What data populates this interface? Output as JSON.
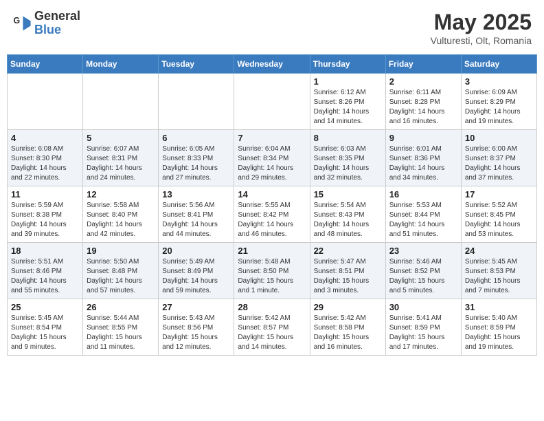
{
  "header": {
    "logo_general": "General",
    "logo_blue": "Blue",
    "month_title": "May 2025",
    "location": "Vulturesti, Olt, Romania"
  },
  "days_of_week": [
    "Sunday",
    "Monday",
    "Tuesday",
    "Wednesday",
    "Thursday",
    "Friday",
    "Saturday"
  ],
  "weeks": [
    [
      {
        "num": "",
        "detail": ""
      },
      {
        "num": "",
        "detail": ""
      },
      {
        "num": "",
        "detail": ""
      },
      {
        "num": "",
        "detail": ""
      },
      {
        "num": "1",
        "detail": "Sunrise: 6:12 AM\nSunset: 8:26 PM\nDaylight: 14 hours\nand 14 minutes."
      },
      {
        "num": "2",
        "detail": "Sunrise: 6:11 AM\nSunset: 8:28 PM\nDaylight: 14 hours\nand 16 minutes."
      },
      {
        "num": "3",
        "detail": "Sunrise: 6:09 AM\nSunset: 8:29 PM\nDaylight: 14 hours\nand 19 minutes."
      }
    ],
    [
      {
        "num": "4",
        "detail": "Sunrise: 6:08 AM\nSunset: 8:30 PM\nDaylight: 14 hours\nand 22 minutes."
      },
      {
        "num": "5",
        "detail": "Sunrise: 6:07 AM\nSunset: 8:31 PM\nDaylight: 14 hours\nand 24 minutes."
      },
      {
        "num": "6",
        "detail": "Sunrise: 6:05 AM\nSunset: 8:33 PM\nDaylight: 14 hours\nand 27 minutes."
      },
      {
        "num": "7",
        "detail": "Sunrise: 6:04 AM\nSunset: 8:34 PM\nDaylight: 14 hours\nand 29 minutes."
      },
      {
        "num": "8",
        "detail": "Sunrise: 6:03 AM\nSunset: 8:35 PM\nDaylight: 14 hours\nand 32 minutes."
      },
      {
        "num": "9",
        "detail": "Sunrise: 6:01 AM\nSunset: 8:36 PM\nDaylight: 14 hours\nand 34 minutes."
      },
      {
        "num": "10",
        "detail": "Sunrise: 6:00 AM\nSunset: 8:37 PM\nDaylight: 14 hours\nand 37 minutes."
      }
    ],
    [
      {
        "num": "11",
        "detail": "Sunrise: 5:59 AM\nSunset: 8:38 PM\nDaylight: 14 hours\nand 39 minutes."
      },
      {
        "num": "12",
        "detail": "Sunrise: 5:58 AM\nSunset: 8:40 PM\nDaylight: 14 hours\nand 42 minutes."
      },
      {
        "num": "13",
        "detail": "Sunrise: 5:56 AM\nSunset: 8:41 PM\nDaylight: 14 hours\nand 44 minutes."
      },
      {
        "num": "14",
        "detail": "Sunrise: 5:55 AM\nSunset: 8:42 PM\nDaylight: 14 hours\nand 46 minutes."
      },
      {
        "num": "15",
        "detail": "Sunrise: 5:54 AM\nSunset: 8:43 PM\nDaylight: 14 hours\nand 48 minutes."
      },
      {
        "num": "16",
        "detail": "Sunrise: 5:53 AM\nSunset: 8:44 PM\nDaylight: 14 hours\nand 51 minutes."
      },
      {
        "num": "17",
        "detail": "Sunrise: 5:52 AM\nSunset: 8:45 PM\nDaylight: 14 hours\nand 53 minutes."
      }
    ],
    [
      {
        "num": "18",
        "detail": "Sunrise: 5:51 AM\nSunset: 8:46 PM\nDaylight: 14 hours\nand 55 minutes."
      },
      {
        "num": "19",
        "detail": "Sunrise: 5:50 AM\nSunset: 8:48 PM\nDaylight: 14 hours\nand 57 minutes."
      },
      {
        "num": "20",
        "detail": "Sunrise: 5:49 AM\nSunset: 8:49 PM\nDaylight: 14 hours\nand 59 minutes."
      },
      {
        "num": "21",
        "detail": "Sunrise: 5:48 AM\nSunset: 8:50 PM\nDaylight: 15 hours\nand 1 minute."
      },
      {
        "num": "22",
        "detail": "Sunrise: 5:47 AM\nSunset: 8:51 PM\nDaylight: 15 hours\nand 3 minutes."
      },
      {
        "num": "23",
        "detail": "Sunrise: 5:46 AM\nSunset: 8:52 PM\nDaylight: 15 hours\nand 5 minutes."
      },
      {
        "num": "24",
        "detail": "Sunrise: 5:45 AM\nSunset: 8:53 PM\nDaylight: 15 hours\nand 7 minutes."
      }
    ],
    [
      {
        "num": "25",
        "detail": "Sunrise: 5:45 AM\nSunset: 8:54 PM\nDaylight: 15 hours\nand 9 minutes."
      },
      {
        "num": "26",
        "detail": "Sunrise: 5:44 AM\nSunset: 8:55 PM\nDaylight: 15 hours\nand 11 minutes."
      },
      {
        "num": "27",
        "detail": "Sunrise: 5:43 AM\nSunset: 8:56 PM\nDaylight: 15 hours\nand 12 minutes."
      },
      {
        "num": "28",
        "detail": "Sunrise: 5:42 AM\nSunset: 8:57 PM\nDaylight: 15 hours\nand 14 minutes."
      },
      {
        "num": "29",
        "detail": "Sunrise: 5:42 AM\nSunset: 8:58 PM\nDaylight: 15 hours\nand 16 minutes."
      },
      {
        "num": "30",
        "detail": "Sunrise: 5:41 AM\nSunset: 8:59 PM\nDaylight: 15 hours\nand 17 minutes."
      },
      {
        "num": "31",
        "detail": "Sunrise: 5:40 AM\nSunset: 8:59 PM\nDaylight: 15 hours\nand 19 minutes."
      }
    ]
  ]
}
